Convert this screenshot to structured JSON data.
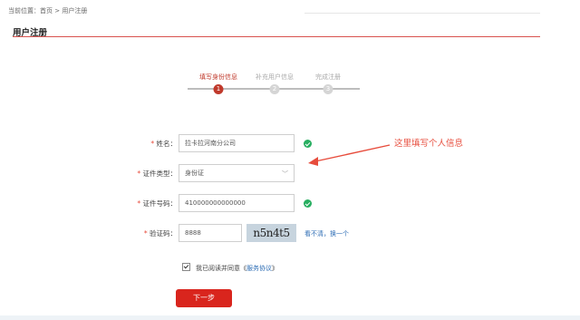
{
  "breadcrumb": "当前位置：首页 > 用户注册",
  "page_title": "用户注册",
  "steps": [
    {
      "number": "1",
      "label": "填写身份信息",
      "state": "active"
    },
    {
      "number": "2",
      "label": "补充用户信息",
      "state": "pending"
    },
    {
      "number": "3",
      "label": "完成注册",
      "state": "pending"
    }
  ],
  "form": {
    "name": {
      "label": "姓名：",
      "value": "拉卡拉河南分公司"
    },
    "id_type": {
      "label": "证件类型：",
      "value": "身份证"
    },
    "id_number": {
      "label": "证件号码：",
      "value": "410000000000000"
    },
    "captcha": {
      "label": "验证码：",
      "value": "8888",
      "image_text": "n5n4t5",
      "refresh_text": "看不清，换一个"
    }
  },
  "agreement": {
    "text": "我已阅读并同意《",
    "link": "服务协议",
    "suffix": "》"
  },
  "next_button": "下一步",
  "annotation": "这里填写个人信息",
  "colors": {
    "accent": "#d9251d",
    "valid": "#27ae60",
    "link": "#2d6db5"
  }
}
